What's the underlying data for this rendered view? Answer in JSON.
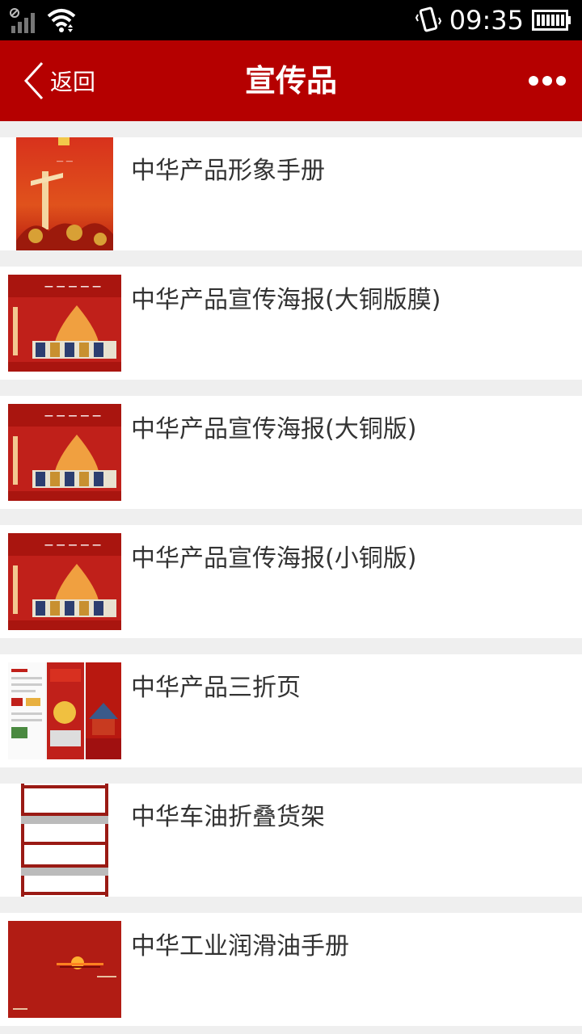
{
  "status_bar": {
    "time": "09:35",
    "icons": [
      "no-sim-icon",
      "signal-icon",
      "wifi-icon",
      "vibrate-icon",
      "battery-icon"
    ]
  },
  "header": {
    "back_label": "返回",
    "title": "宣传品",
    "more_icon": "more-icon"
  },
  "items": [
    {
      "title": "中华产品形象手册",
      "thumb": "brochure-cover"
    },
    {
      "title": "中华产品宣传海报(大铜版膜)",
      "thumb": "poster"
    },
    {
      "title": "中华产品宣传海报(大铜版)",
      "thumb": "poster"
    },
    {
      "title": "中华产品宣传海报(小铜版)",
      "thumb": "poster"
    },
    {
      "title": "中华产品三折页",
      "thumb": "trifold"
    },
    {
      "title": "中华车油折叠货架",
      "thumb": "display-rack"
    },
    {
      "title": "中华工业润滑油手册",
      "thumb": "industrial-manual"
    }
  ],
  "colors": {
    "header_red": "#b50000",
    "status_black": "#000000",
    "list_bg": "#efefef",
    "text": "#333333"
  }
}
